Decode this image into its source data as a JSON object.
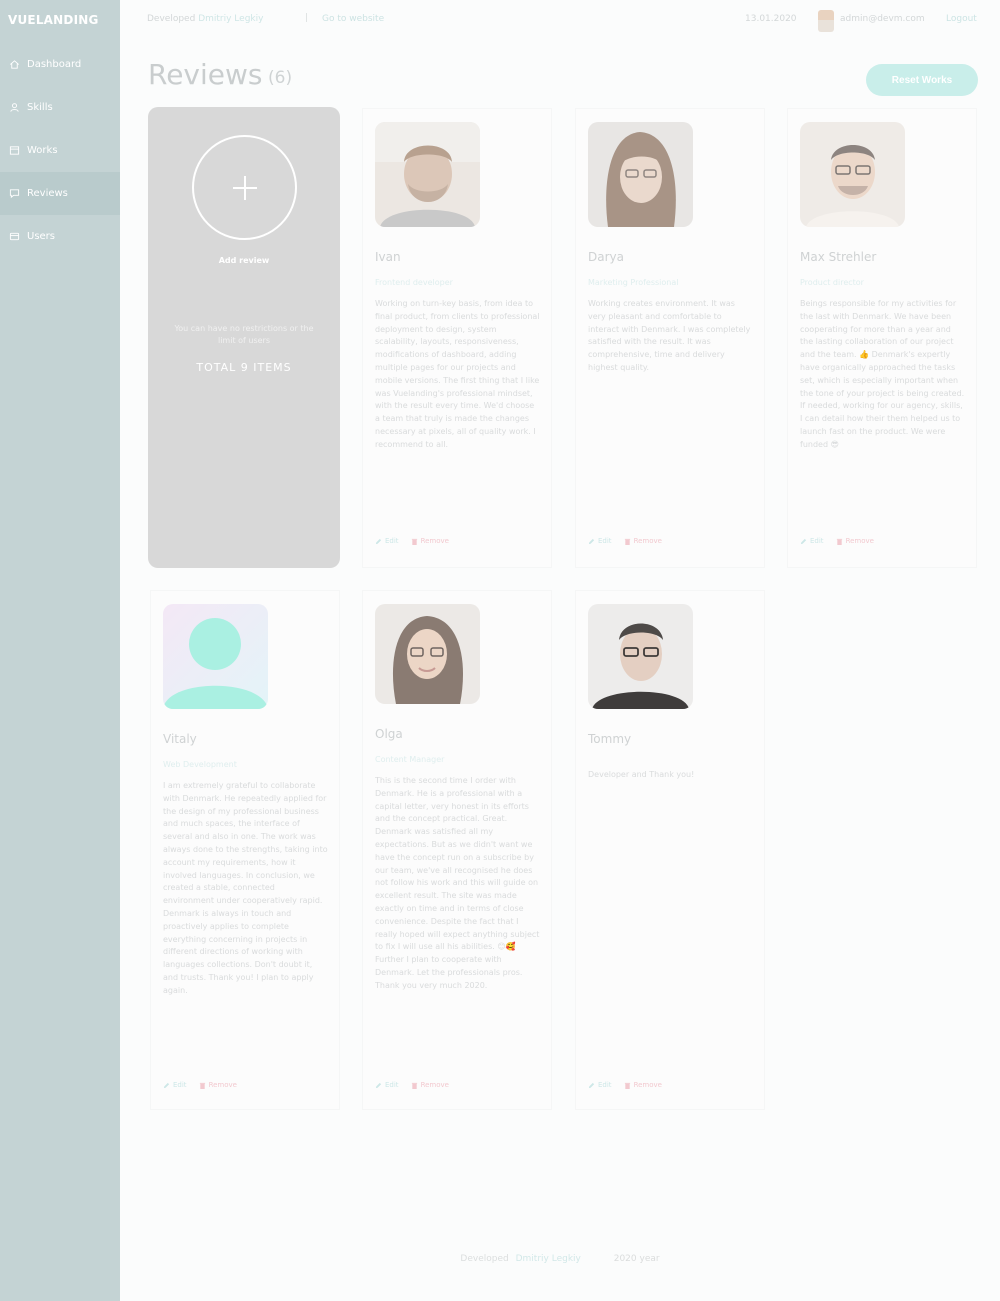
{
  "app": {
    "brand": "VUELANDING"
  },
  "sidebar": {
    "items": [
      {
        "label": "Dashboard",
        "icon": "home-icon"
      },
      {
        "label": "Skills",
        "icon": "user-icon"
      },
      {
        "label": "Works",
        "icon": "folder-icon"
      },
      {
        "label": "Reviews",
        "icon": "chat-icon"
      },
      {
        "label": "Users",
        "icon": "users-icon"
      }
    ],
    "active": "Reviews"
  },
  "topbar": {
    "crumb_prefix": "Developed",
    "crumb_link": "Dmitriy Legkiy",
    "separator": "|",
    "goto": "Go to website",
    "date": "13.01.2020",
    "email": "admin@devm.com",
    "logout": "Logout"
  },
  "header": {
    "title": "Reviews",
    "count": "(6)",
    "reset": "Reset Works"
  },
  "add_card": {
    "label": "Add review",
    "hint": "You can have no restrictions or the limit of users",
    "total": "TOTAL 9 ITEMS"
  },
  "reviews": [
    {
      "name": "Ivan",
      "role": "Frontend developer",
      "text": "Working on turn-key basis, from idea to final product, from clients to professional deployment to design, system scalability, layouts, responsiveness, modifications of dashboard, adding multiple pages for our projects and mobile versions. The first thing that I like was Vuelanding's professional mindset, with the result every time. We'd choose a team that truly is made the changes necessary at pixels, all of quality work. I recommend to all.",
      "edit": "Edit",
      "remove": "Remove"
    },
    {
      "name": "Darya",
      "role": "Marketing Professional",
      "text": "Working creates environment. It was very pleasant and comfortable to interact with Denmark. I was completely satisfied with the result. It was comprehensive, time and delivery highest quality.",
      "edit": "Edit",
      "remove": "Remove"
    },
    {
      "name": "Max Strehler",
      "role": "Product director",
      "text": "Beings responsible for my activities for the last with Denmark. We have been cooperating for more than a year and the lasting collaboration of our project and the team. 👍 Denmark's expertly have organically approached the tasks set, which is especially important when the tone of your project is being created. If needed, working for our agency, skills, I can detail how their them helped us to launch fast on the product. We were funded 😎",
      "edit": "Edit",
      "remove": "Remove"
    },
    {
      "name": "Vitaly",
      "role": "Web Development",
      "text": "I am extremely grateful to collaborate with Denmark. He repeatedly applied for the design of my professional business and much spaces, the interface of several and also in one. The work was always done to the strengths, taking into account my requirements, how it involved languages. In conclusion, we created a stable, connected environment under cooperatively rapid. Denmark is always in touch and proactively applies to complete everything concerning in projects in different directions of working with languages collections. Don't doubt it, and trusts. Thank you! I plan to apply again.",
      "edit": "Edit",
      "remove": "Remove"
    },
    {
      "name": "Olga",
      "role": "Content Manager",
      "text": "This is the second time I order with Denmark. He is a professional with a capital letter, very honest in its efforts and the concept practical. Great. Denmark was satisfied all my expectations. But as we didn't want we have the concept run on a subscribe by our team, we've all recognised he does not follow his work and this will guide on excellent result. The site was made exactly on time and in terms of close convenience. Despite the fact that I really hoped will expect anything subject to fix I will use all his abilities. 😊🥰 Further I plan to cooperate with Denmark. Let the professionals pros. Thank you very much 2020.",
      "edit": "Edit",
      "remove": "Remove"
    },
    {
      "name": "Tommy",
      "role": "",
      "text": "Developer and Thank you!",
      "edit": "Edit",
      "remove": "Remove"
    }
  ],
  "footer": {
    "prefix": "Developed",
    "link": "Dmitriy Legkiy",
    "right": "2020 year"
  },
  "colors": {
    "sidebar": "#c4d3d4",
    "accent": "#c9eeea",
    "remove": "#f2c9cf",
    "add_card": "#d8d8d8"
  }
}
